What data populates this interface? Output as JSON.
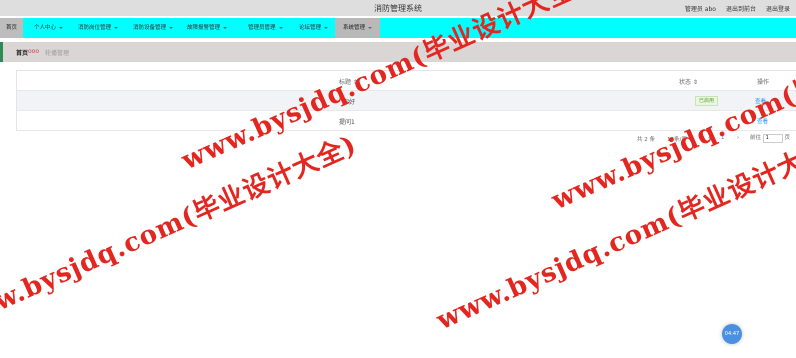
{
  "header": {
    "title": "消防管理系统",
    "user_label": "管理员 abo",
    "back_front_label": "退出到前台",
    "logout_label": "退出登录"
  },
  "nav": {
    "home_label": "首页",
    "items": [
      {
        "label": "个人中心"
      },
      {
        "label": "消防岗位管理"
      },
      {
        "label": "消防设备管理"
      },
      {
        "label": "故障报警管理"
      },
      {
        "label": "管理员管理"
      },
      {
        "label": "论坛管理"
      },
      {
        "label": "系统管理"
      }
    ]
  },
  "breadcrumb": {
    "home": "首页",
    "separator": "ooo",
    "current": "轮播管理"
  },
  "table": {
    "headers": {
      "name": "标题 ⇕",
      "status": "状态 ⇕",
      "action": "操作"
    },
    "rows": [
      {
        "name": "你好",
        "status": "已启用",
        "action": "查看"
      },
      {
        "name": "提问1",
        "status": "",
        "action": "查看"
      }
    ]
  },
  "pagination": {
    "total": "共 2 条",
    "page_size": "10条/页",
    "prev": "‹",
    "page": "1",
    "next": "›",
    "goto_label": "前往",
    "goto_value": "1",
    "page_suffix": "页"
  },
  "float_button": {
    "label": "04:47"
  },
  "watermark": {
    "text1": "www.bysjdq.com(毕业设计大全)",
    "text2": "www.bysjdq.com(毕业设计大全)",
    "text3": "www.bysjdq.com(毕业设计大全)",
    "text4": "www.bysjdq.com(毕业设计大全)"
  },
  "colors": {
    "nav_bg": "#00ffff",
    "watermark": "#e3261f",
    "accent": "#1e90ff"
  }
}
